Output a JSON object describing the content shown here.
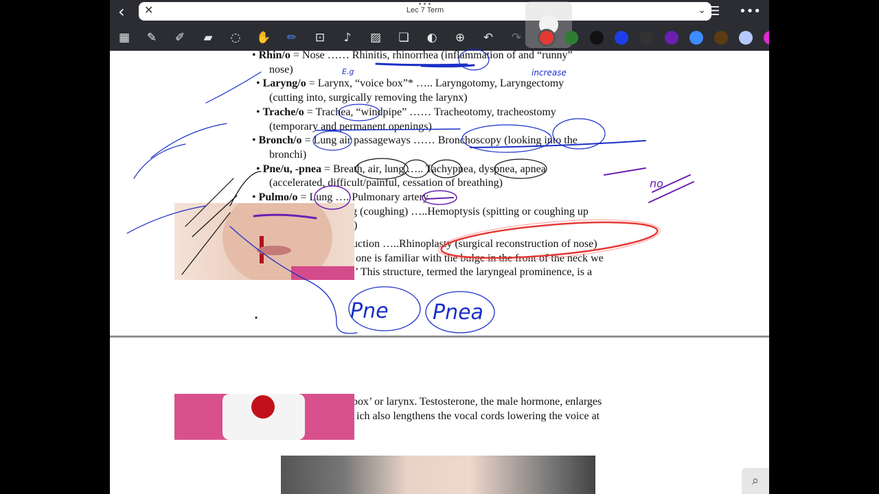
{
  "app": {
    "document_title": "Lec 7 Term",
    "title_dots": "•••",
    "back_glyph": "‹",
    "close_glyph": "✕",
    "chevron_glyph": "⌄",
    "list_glyph": "☰",
    "more_glyph": "•••"
  },
  "toolbar": {
    "tools": [
      "grid-icon",
      "pen-icon",
      "highlighter-icon",
      "eraser-icon",
      "lasso-icon",
      "hand-icon",
      "pencil-icon",
      "text-box-icon",
      "microphone-icon",
      "image-icon",
      "shapes-icon",
      "sticker-icon",
      "add-icon",
      "undo-icon",
      "redo-icon"
    ],
    "colors": [
      "#e53935",
      "#2e7d32",
      "#111111",
      "#1e3de8",
      "#333333",
      "#6a1fb0",
      "#3f8cff",
      "#5a3c10",
      "#b3c9ff",
      "#e02ad0"
    ]
  },
  "document": {
    "rhino_term": "Rhin/o",
    "rhino_def": " = Nose …… Rhinitis, rhinorrhea (inflammation of and “runny”",
    "rhino_cont": "nose)",
    "laryng_term": "Laryng/o",
    "laryng_def": " = Larynx, “voice box”* …..  Laryngotomy, Laryngectomy",
    "laryng_cont": "(cutting into, surgically removing the larynx)",
    "trache_term": "Trache/o",
    "trache_def": " = Trachea, “windpipe” …… Tracheotomy, tracheostomy",
    "trache_cont": "(temporary and permanent openings)",
    "bronch_term": "Bronch/o",
    "bronch_def": " = Lung air passageways …… Bronchoscopy (looking into the",
    "bronch_cont": "bronchi)",
    "pne_term": "Pne/u, -pnea",
    "pne_def": " = Breath, air, lung ….. Tachypnea, dyspnea, apnea",
    "pne_cont": "(accelerated, difficult/painful, cessation of breathing)",
    "pulmo_term": "Pulmo/o",
    "pulmo_def": " = Lung …. Pulmonary artery",
    "line_coughing": "g (coughing)  …..Hemoptysis (spitting or coughing up",
    "line_paren": ")",
    "line_rhinoplasty": "uction  …..Rhinoplasty (surgical reconstruction of nose)",
    "line_bulge": "one is familiar with the bulge in the front of the neck we",
    "line_structure": "’ This structure, termed the laryngeal prominence, is a",
    "line_box": "box’ or larynx. Testosterone, the male hormone, enlarges",
    "line_lengthens": "ich also lengthens the vocal cords lowering the voice at",
    "bullet": "•"
  },
  "annotations": {
    "pne_word": "Pne",
    "pnea_word": "Pnea",
    "eg": "E.g",
    "increase": "increase",
    "no": "no"
  }
}
